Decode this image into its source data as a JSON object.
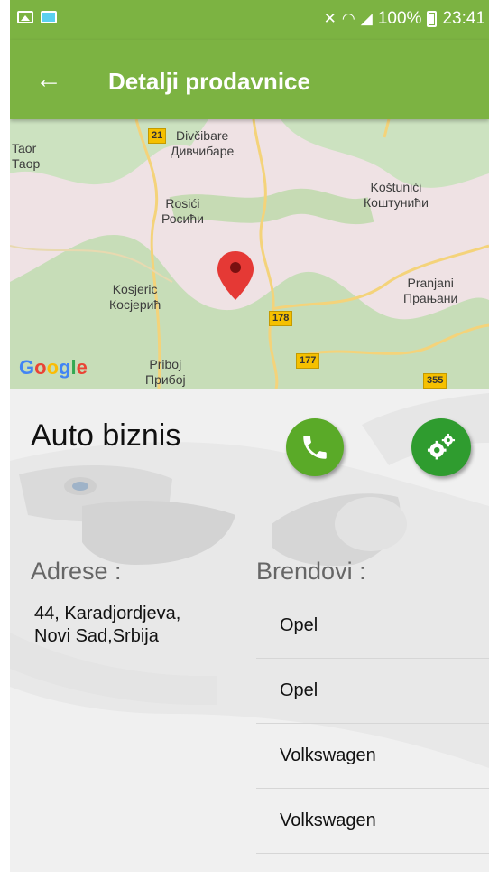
{
  "status_bar": {
    "battery": "100%",
    "time": "23:41"
  },
  "app_bar": {
    "title": "Detalji prodavnice"
  },
  "map": {
    "places": [
      {
        "lat": "Taor",
        "cyr": "Таор"
      },
      {
        "lat": "Divčibare",
        "cyr": "Дивчибаре"
      },
      {
        "lat": "Rosići",
        "cyr": "Росићи"
      },
      {
        "lat": "Koštunići",
        "cyr": "Коштунићи"
      },
      {
        "lat": "Kosjeric",
        "cyr": "Косјерић"
      },
      {
        "lat": "Pranjani",
        "cyr": "Прањани"
      },
      {
        "lat": "Priboj",
        "cyr": "Прибој"
      }
    ],
    "road_numbers": [
      "21",
      "178",
      "177",
      "355"
    ],
    "logo": "Google"
  },
  "shop": {
    "name": "Auto biznis",
    "address_label": "Adrese :",
    "address_lines": [
      "44, Karadjordjeva,",
      "Novi Sad,Srbija"
    ],
    "brands_label": "Brendovi :",
    "brands": [
      "Opel",
      "Opel",
      "Volkswagen",
      "Volkswagen"
    ]
  },
  "colors": {
    "accent": "#7cb342",
    "call": "#5aaa28",
    "settings": "#2f9c2f",
    "pin": "#e53935"
  }
}
